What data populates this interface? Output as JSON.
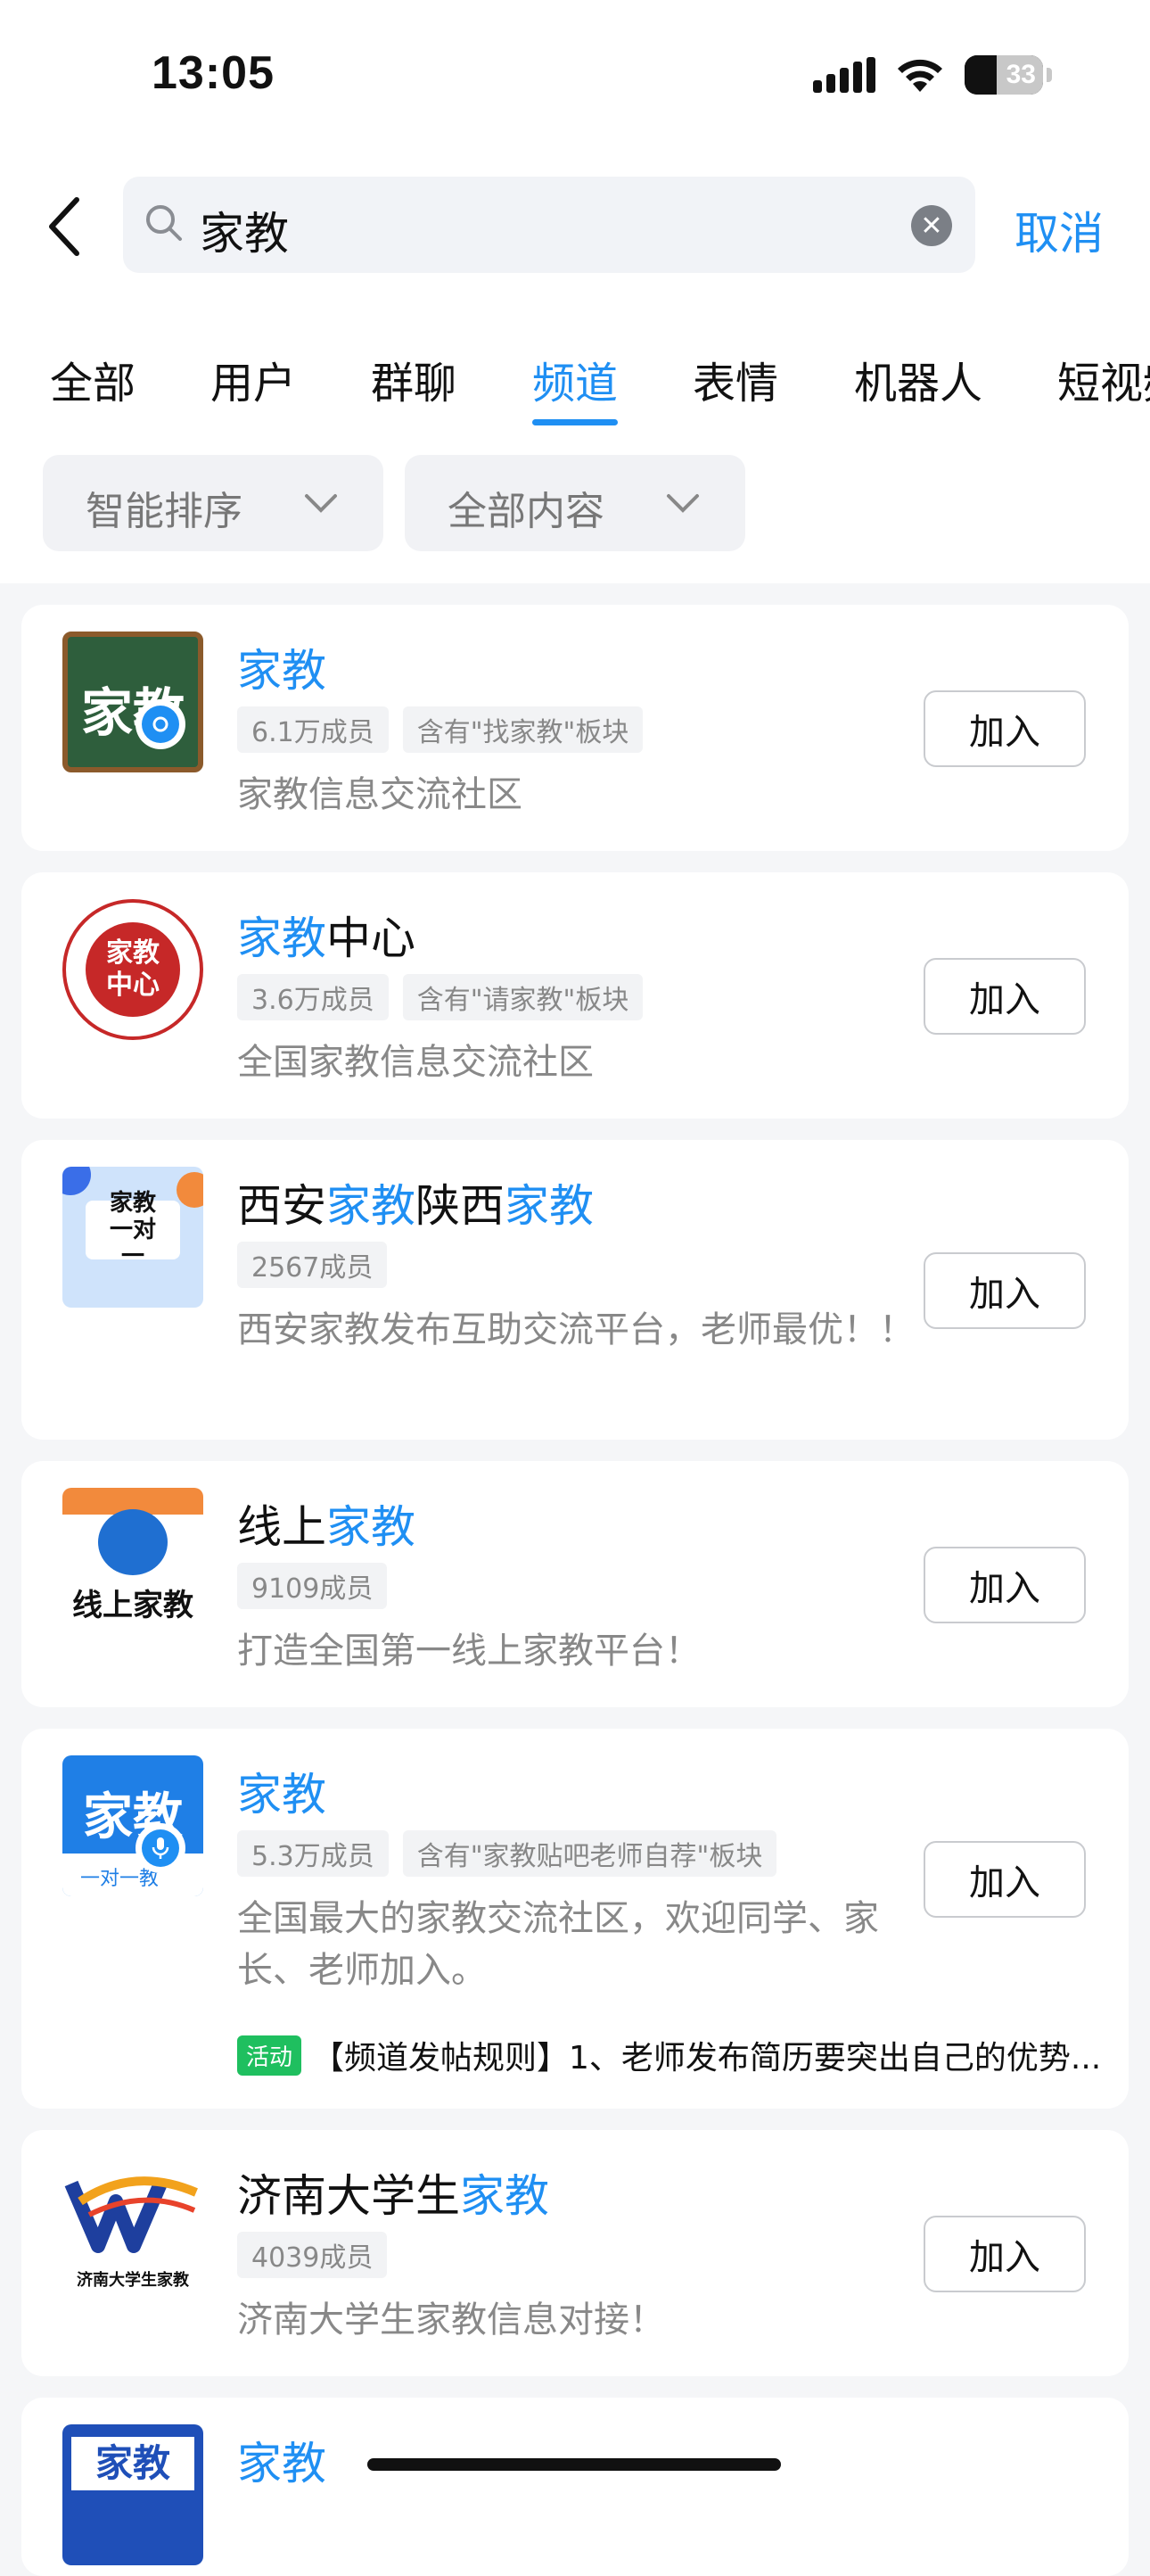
{
  "status_bar": {
    "time": "13:05",
    "battery": "33"
  },
  "search": {
    "query": "家教",
    "cancel_label": "取消"
  },
  "tabs": [
    {
      "label": "全部",
      "active": false
    },
    {
      "label": "用户",
      "active": false
    },
    {
      "label": "群聊",
      "active": false
    },
    {
      "label": "频道",
      "active": true
    },
    {
      "label": "表情",
      "active": false
    },
    {
      "label": "机器人",
      "active": false
    },
    {
      "label": "短视频",
      "active": false
    }
  ],
  "filters": {
    "sort_label": "智能排序",
    "content_label": "全部内容"
  },
  "join_label": "加入",
  "results": [
    {
      "title_parts": [
        {
          "t": "家教",
          "hl": true
        }
      ],
      "members": "6.1万成员",
      "extra_chip": "含有\"找家教\"板块",
      "desc": "家教信息交流社区",
      "logo_text": "家教"
    },
    {
      "title_parts": [
        {
          "t": "家教",
          "hl": true
        },
        {
          "t": "中心",
          "hl": false
        }
      ],
      "members": "3.6万成员",
      "extra_chip": "含有\"请家教\"板块",
      "desc": "全国家教信息交流社区",
      "logo_text": "家教中心"
    },
    {
      "title_parts": [
        {
          "t": "西安",
          "hl": false
        },
        {
          "t": "家教",
          "hl": true
        },
        {
          "t": "陕西",
          "hl": false
        },
        {
          "t": "家教",
          "hl": true
        }
      ],
      "members": "2567成员",
      "extra_chip": "",
      "desc": "西安家教发布互助交流平台，老师最优！！",
      "logo_text": "家教一对一"
    },
    {
      "title_parts": [
        {
          "t": "线上",
          "hl": false
        },
        {
          "t": "家教",
          "hl": true
        }
      ],
      "members": "9109成员",
      "extra_chip": "",
      "desc": "打造全国第一线上家教平台！",
      "logo_text": "线上家教"
    },
    {
      "title_parts": [
        {
          "t": "家教",
          "hl": true
        }
      ],
      "members": "5.3万成员",
      "extra_chip": "含有\"家教贴吧老师自荐\"板块",
      "desc": "全国最大的家教交流社区，欢迎同学、家长、老师加入。",
      "logo_text": "家教",
      "logo_sub": "一对一教",
      "activity_tag": "活动",
      "activity_text": "【频道发帖规则】1、老师发布简历要突出自己的优势..."
    },
    {
      "title_parts": [
        {
          "t": "济南大学生",
          "hl": false
        },
        {
          "t": "家教",
          "hl": true
        }
      ],
      "members": "4039成员",
      "extra_chip": "",
      "desc": "济南大学生家教信息对接！",
      "logo_text": "济南大学生家教"
    },
    {
      "title_parts": [
        {
          "t": "家教",
          "hl": true
        }
      ],
      "logo_text": "家教"
    }
  ]
}
